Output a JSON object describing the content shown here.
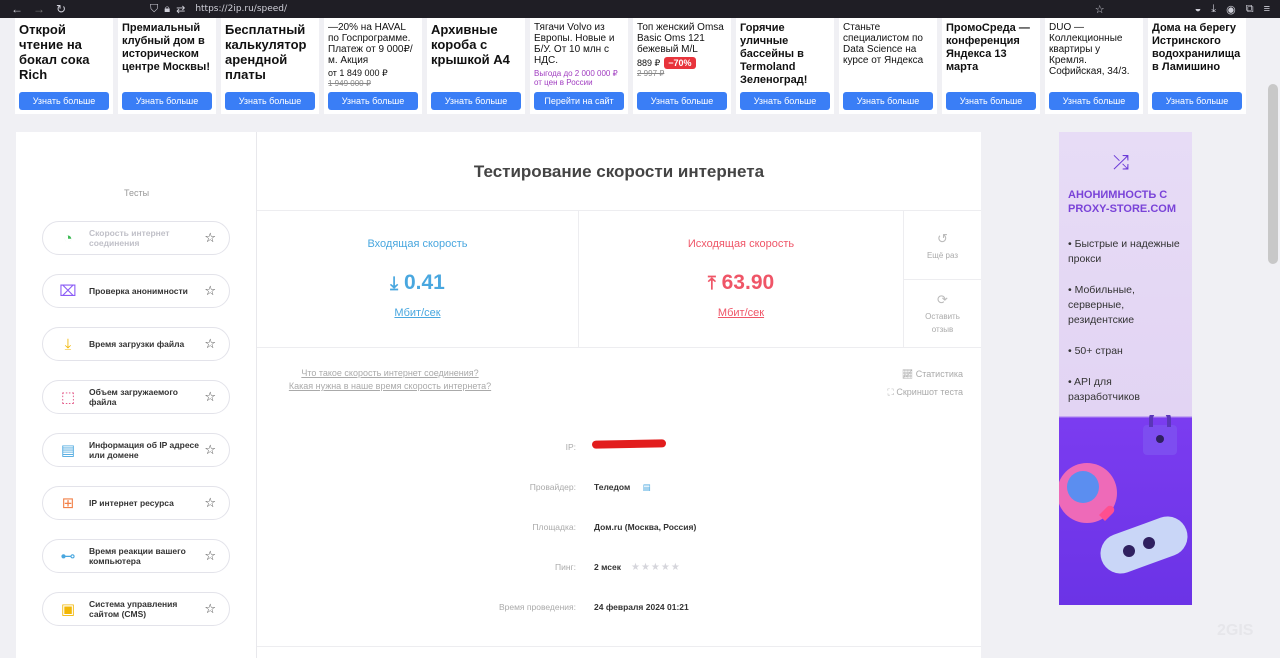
{
  "browser": {
    "url": "https://2ip.ru/speed/",
    "nav_icons": [
      "back-icon",
      "forward-icon",
      "reload-icon"
    ],
    "right_icons": [
      "pocket-icon",
      "download-icon",
      "account-icon",
      "extensions-icon",
      "menu-icon"
    ]
  },
  "ads": [
    {
      "title": "Открой чтение на бокал сока Rich",
      "style": "big",
      "button": "Узнать больше"
    },
    {
      "title": "Премиальный клубный дом в историческом центре Москвы!",
      "style": "mid",
      "button": "Узнать больше"
    },
    {
      "title": "Бесплатный калькулятор арендной платы",
      "style": "big",
      "button": "Узнать больше"
    },
    {
      "title": "—20% на HAVAL по Госпрограмме. Платеж от 9 000₽/м. Акция",
      "style": "small",
      "price": "от 1 849 000 ₽",
      "old_price": "1 949 000 ₽",
      "button": "Узнать больше"
    },
    {
      "title": "Архивные короба с крышкой А4",
      "style": "big",
      "button": "Узнать больше"
    },
    {
      "title": "Тягачи Volvo из Европы. Новые и Б/У. От 10 млн с НДС.",
      "style": "small",
      "promo": "Выгода до 2 000 000 ₽ от цен в России",
      "button": "Перейти на сайт"
    },
    {
      "title": "Топ женский Omsa Basic Oms 121 бежевый M/L",
      "style": "small",
      "price": "889 ₽",
      "old_price": "2 997 ₽",
      "discount": "−70%",
      "button": "Узнать больше"
    },
    {
      "title": "Горячие уличные бассейны в Termoland Зеленоград!",
      "style": "mid",
      "button": "Узнать больше"
    },
    {
      "title": "Станьте специалистом по Data Science на курсе от Яндекса",
      "style": "small",
      "button": "Узнать больше"
    },
    {
      "title": "ПромоСреда — конференция Яндекса 13 марта",
      "style": "mid",
      "button": "Узнать больше"
    },
    {
      "title": "DUO — Коллекционные квартиры у Кремля. Софийская, 34/3.",
      "style": "small",
      "button": "Узнать больше"
    },
    {
      "title": "Дома на берегу Истринского водохранилища в Ламишино",
      "style": "mid",
      "button": "Узнать больше"
    }
  ],
  "sidebar": {
    "header": "Тесты",
    "items": [
      {
        "label": "Скорость интернет соединения",
        "icon": "speedometer-icon",
        "color": "#3cba54"
      },
      {
        "label": "Проверка анонимности",
        "icon": "anonymity-icon",
        "color": "#8b5cf6"
      },
      {
        "label": "Время загрузки файла",
        "icon": "download-file-icon",
        "color": "#f2b705"
      },
      {
        "label": "Объем загружаемого файла",
        "icon": "file-size-icon",
        "color": "#e0457b"
      },
      {
        "label": "Информация об IP адресе или домене",
        "icon": "ip-info-icon",
        "color": "#49a7df"
      },
      {
        "label": "IP интернет ресурса",
        "icon": "web-resource-icon",
        "color": "#f2824a"
      },
      {
        "label": "Время реакции вашего компьютера",
        "icon": "network-icon",
        "color": "#49a7df"
      },
      {
        "label": "Система управления сайтом (CMS)",
        "icon": "cms-icon",
        "color": "#f2b705"
      }
    ]
  },
  "main": {
    "title": "Тестирование скорости интернета",
    "download": {
      "label": "Входящая скорость",
      "value": "0.41",
      "unit": "Мбит/сек"
    },
    "upload": {
      "label": "Исходящая скорость",
      "value": "63.90",
      "unit": "Мбит/сек"
    },
    "retry": "Ещё раз",
    "feedback": "Оставить отзыв",
    "links": [
      "Что такое скорость интернет соединения?",
      "Какая нужна в наше время скорость интернета?"
    ],
    "tools": [
      "Статистика",
      "Скриншот теста"
    ],
    "info": [
      {
        "key": "IP:",
        "value": ""
      },
      {
        "key": "Провайдер:",
        "value": "Теледом"
      },
      {
        "key": "Площадка:",
        "value": "Дом.ru (Москва, Россия)"
      },
      {
        "key": "Пинг:",
        "value": "2 мсек"
      },
      {
        "key": "Время проведения:",
        "value": "24 февраля 2024 01:21"
      }
    ]
  },
  "right_ad": {
    "title": "АНОНИМНОСТЬ С PROXY-STORE.COM",
    "bullets": [
      "• Быстрые и надежные прокси",
      "• Мобильные, серверные, резидентские",
      "• 50+ стран",
      "• API для разработчиков"
    ]
  },
  "watermark": "2GIS"
}
